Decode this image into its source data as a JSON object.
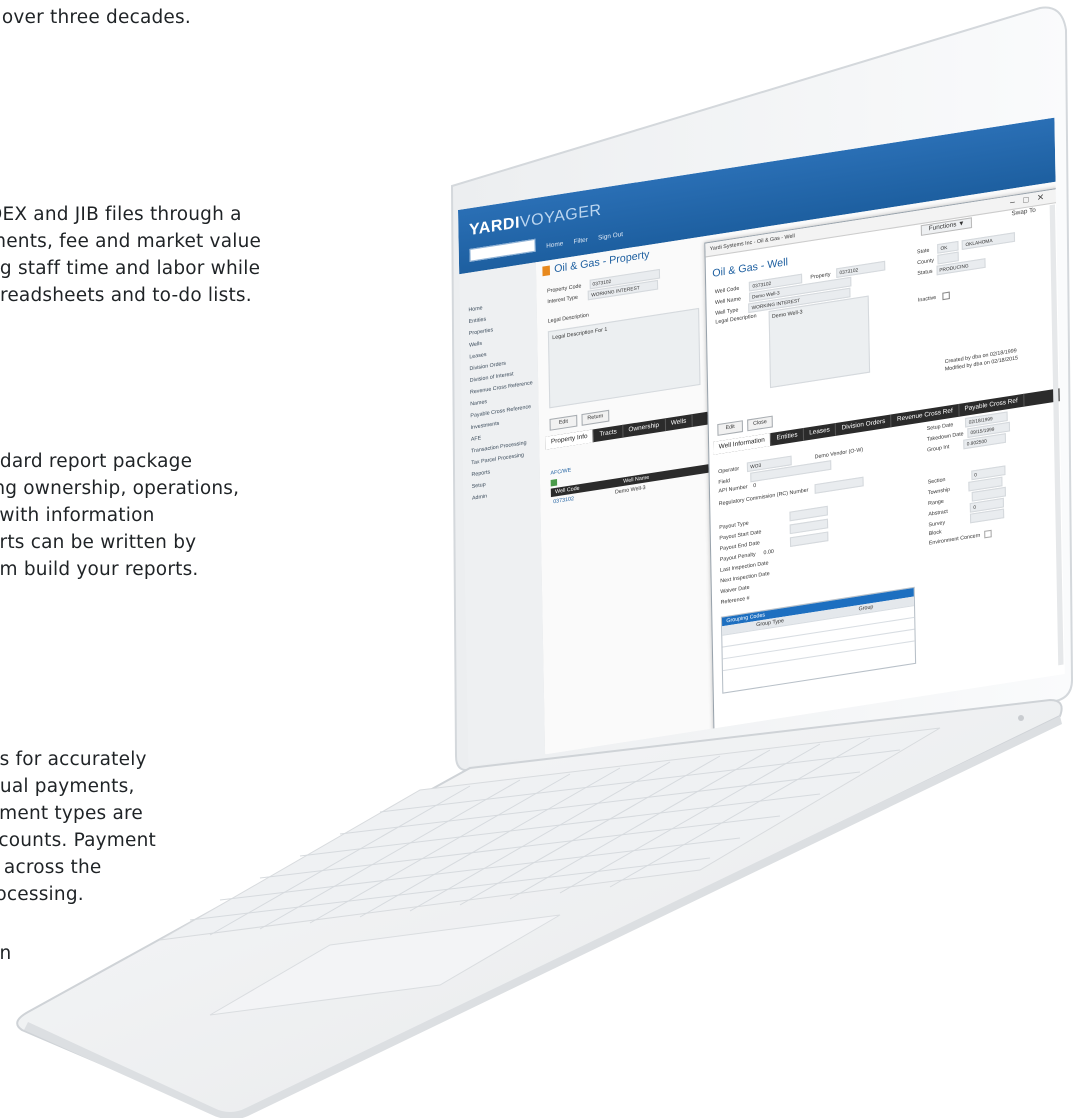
{
  "copy": {
    "p1": [
      "r over three decades."
    ],
    "p2": [
      "DEX and JIB files through a",
      "ments, fee and market value",
      "ng staff time and labor while",
      "preadsheets and to-do lists."
    ],
    "p3": [
      "ndard report package",
      "ing ownership, operations,",
      "l with information",
      "orts can be written by",
      "om build your reports."
    ],
    "p4": [
      "es for accurately",
      "nual payments,",
      "yment types are",
      "ccounts. Payment",
      "s across the",
      "rocessing."
    ],
    "p5": [
      "on"
    ]
  },
  "app": {
    "logo_strong": "YARDI",
    "logo_light": "VOYAGER",
    "topnav": [
      "Home",
      "Filter",
      "Sign Out"
    ],
    "sidebar": [
      "Home",
      "Entities",
      "Properties",
      "Wells",
      "Leases",
      "Division Orders",
      "Division of Interest",
      "Revenue Cross Reference",
      "Names",
      "Payable Cross Reference",
      "Investments",
      "AFE",
      "Transaction Processing",
      "Tax Parcel Processing",
      "Reports",
      "Setup",
      "Admin"
    ],
    "property": {
      "title": "Oil & Gas - Property",
      "code_label": "Property Code",
      "code_value": "0373102",
      "type_label": "Interest Type",
      "type_value": "WORKING INTEREST",
      "legal_label": "Legal Description",
      "legal_text": "Legal Description For 1",
      "edit": "Edit",
      "return": "Return",
      "tabs": [
        "Property Info",
        "Tracts",
        "Ownership",
        "Wells"
      ],
      "grid_label": "AFC/WE",
      "grid_cols": [
        "Well Code",
        "Well Name"
      ],
      "grid_row": [
        "0373102",
        "Demo Well-3"
      ]
    },
    "well": {
      "window_title": "Yardi Systems Inc - Oil & Gas - Well",
      "functions": "Functions ▼",
      "swap_to": "Swap To",
      "title": "Oil & Gas - Well",
      "well_code_label": "Well Code",
      "well_code": "0373102",
      "property_label": "Property",
      "property": "0373102",
      "well_name_label": "Well Name",
      "well_name": "Demo Well-3",
      "well_type_label": "Well Type",
      "well_type": "WORKING INTEREST",
      "legal_label": "Legal Description",
      "legal": "Demo Well-3",
      "state_label": "State",
      "state": "OK",
      "state_name": "OKLAHOMA",
      "county_label": "County",
      "status_label": "Status",
      "status": "PRODUCING",
      "inactive_label": "Inactive",
      "created": "Created by dba on 02/18/1999",
      "modified": "Modified by dba on 02/18/2015",
      "edit": "Edit",
      "close": "Close",
      "tabs": [
        "Well Information",
        "Entities",
        "Leases",
        "Division Orders",
        "Revenue Cross Ref",
        "Payable Cross Ref"
      ],
      "operator_label": "Operator",
      "operator": "WO3",
      "operator_name": "Demo Vendor (O-W)",
      "field_label": "Field",
      "api_label": "API Number",
      "api": "0",
      "rin_label": "Regulatory Commission (RC) Number",
      "setup_label": "Setup Date",
      "setup": "02/18/1999",
      "takedown_label": "Takedown Date",
      "takedown": "09/15/1999",
      "group_label": "Group Int",
      "group": "0.902500",
      "section_label": "Section",
      "section": "0",
      "township_label": "Township",
      "range_label": "Range",
      "abstract_label": "Abstract",
      "abstract": "0",
      "survey_label": "Survey",
      "block_label": "Block",
      "env_label": "Environment Concern",
      "left_labels": [
        "Payout Type",
        "Payout Start Date",
        "Payout End Date",
        "Payout Penalty",
        "Last Inspection Date",
        "Next Inspection Date",
        "Waiver Date",
        "Reference #"
      ],
      "payout_penalty": "0.00",
      "grouping_title": "Grouping Codes",
      "grouping_cols": [
        "Group Type",
        "Group"
      ]
    }
  }
}
